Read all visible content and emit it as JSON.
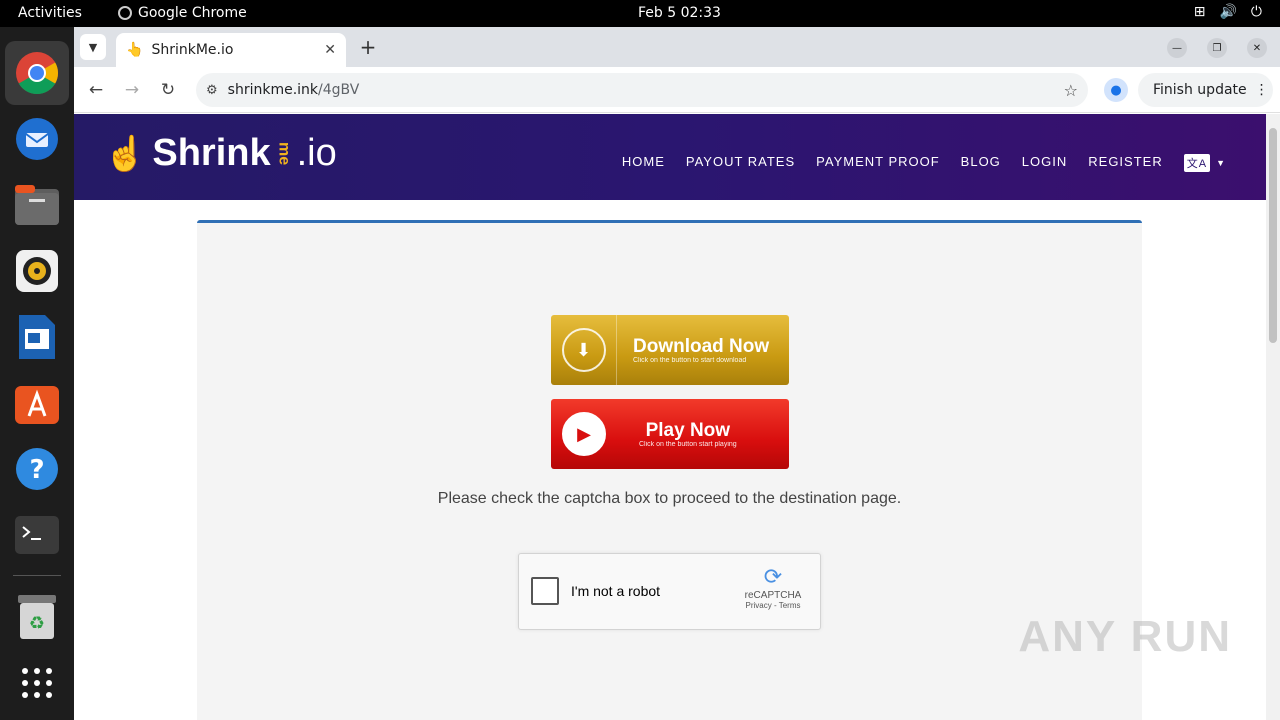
{
  "system": {
    "activities": "Activities",
    "app_name": "Google Chrome",
    "clock": "Feb 5  02:33"
  },
  "browser": {
    "tab_title": "ShrinkMe.io",
    "url_host": "shrinkme.ink",
    "url_path": "/4gBV",
    "finish_update": "Finish update"
  },
  "site": {
    "logo_text": "Shrink",
    "logo_me": "me",
    "logo_tld": ".io",
    "nav": [
      "HOME",
      "PAYOUT RATES",
      "PAYMENT PROOF",
      "BLOG",
      "LOGIN",
      "REGISTER"
    ]
  },
  "content": {
    "download_title": "Download Now",
    "download_sub": "Click on the button to start download",
    "play_title": "Play Now",
    "play_sub": "Click on the button start playing",
    "captcha_message": "Please check the captcha box to proceed to the destination page.",
    "recaptcha_label": "I'm not a robot",
    "recaptcha_brand": "reCAPTCHA",
    "recaptcha_links": "Privacy - Terms"
  },
  "watermark": "ANY RUN",
  "colors": {
    "header_gradient_start": "#251a66",
    "header_gradient_end": "#3b0f6e",
    "download_gold": "#c99a12",
    "play_red": "#d80e0e",
    "card_border": "#2f6fb5"
  }
}
